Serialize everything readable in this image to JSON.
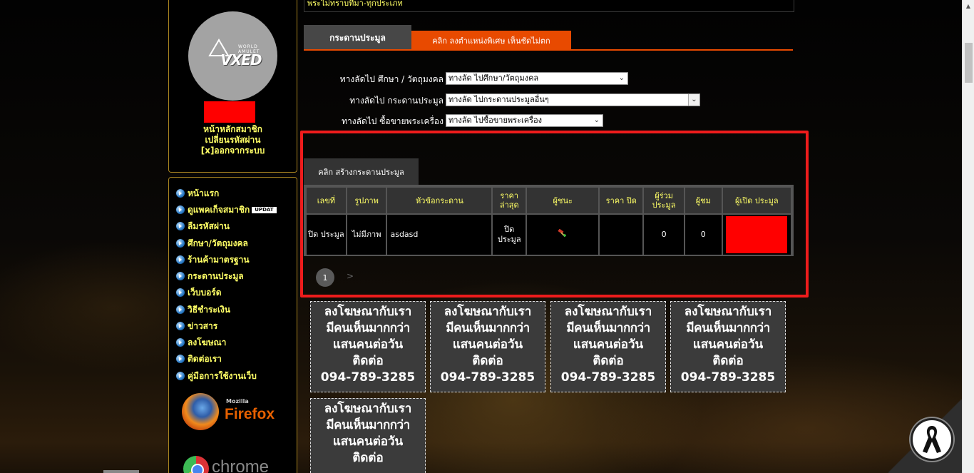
{
  "top_strip": {
    "text": "พระไม่ทราบที่มา-ทุกประเภท"
  },
  "member": {
    "logo_text": "VXED",
    "logo_small": "WORLD AMULET",
    "links": [
      "หน้าหลักสมาชิก",
      "เปลี่ยนรหัสผ่าน",
      "[x]ออกจากระบบ"
    ]
  },
  "menu": {
    "items": [
      {
        "label": "หน้าแรก"
      },
      {
        "label": "ดูแพคเก็จสมาชิก",
        "badge": "UPDAT"
      },
      {
        "label": "ลืมรหัสผ่าน"
      },
      {
        "label": "ศึกษา/วัตถุมงคล"
      },
      {
        "label": "ร้านค้ามาตรฐาน"
      },
      {
        "label": "กระดานประมูล"
      },
      {
        "label": "เว็บบอร์ด"
      },
      {
        "label": "วิธีชำระเงิน"
      },
      {
        "label": "ข่าวสาร"
      },
      {
        "label": "ลงโฆษณา"
      },
      {
        "label": "ติดต่อเรา"
      },
      {
        "label": "คู่มือการใช้งานเว็บ"
      }
    ],
    "firefox": {
      "small": "Mozilla",
      "word": "Firefox"
    },
    "chrome": {
      "word": "chrome"
    }
  },
  "tabs": {
    "main": "กระดานประมูล",
    "special": "คลิก ลงตำแหน่งพิเศษ เห็นชัดไม่ตก"
  },
  "shortcuts": [
    {
      "label": "ทางลัดไป ศึกษา / วัตถุมงคล",
      "value": "ทางลัด ไปศึกษา/วัตถุมงคล"
    },
    {
      "label": "ทางลัดไป กระดานประมูล",
      "value": "ทางลัด ไปกระดานประมูลอื่นๆ"
    },
    {
      "label": "ทางลัดไป ซื้อขายพระเครื่อง",
      "value": "ทางลัด ไปซื้อขายพระเครื่อง"
    }
  ],
  "board": {
    "create_tab": "คลิก สร้างกระดานประมูล",
    "headers": [
      "เลขที่",
      "รูปภาพ",
      "หัวข้อกระดาน",
      "ราคา ล่าสุด",
      "ผู้ชนะ",
      "ราคา ปิด",
      "ผู้ร่วม ประมูล",
      "ผู้ชม",
      "ผู้เปิด ประมูล"
    ],
    "rows": [
      {
        "number": "ปิด ประมูล",
        "image": "ไม่มีภาพ",
        "title": "asdasd",
        "last_price": "ปิด ประมูล",
        "winner_icon": "gavel-icon",
        "close_price": "",
        "bidders": "0",
        "viewers": "0"
      }
    ],
    "pagination": {
      "current": "1",
      "next": ">"
    }
  },
  "ads": {
    "line1": "ลงโฆษณากับเรา",
    "line2": "มีคนเห็นมากกว่า",
    "line3": "แสนคนต่อวัน",
    "line4": "ติดต่อ",
    "phone": "094-789-3285"
  },
  "colors": {
    "accent_orange": "#e84a00",
    "highlight_red": "#ee1c1c",
    "menu_yellow": "#ffff66",
    "panel_border": "#a88420"
  }
}
